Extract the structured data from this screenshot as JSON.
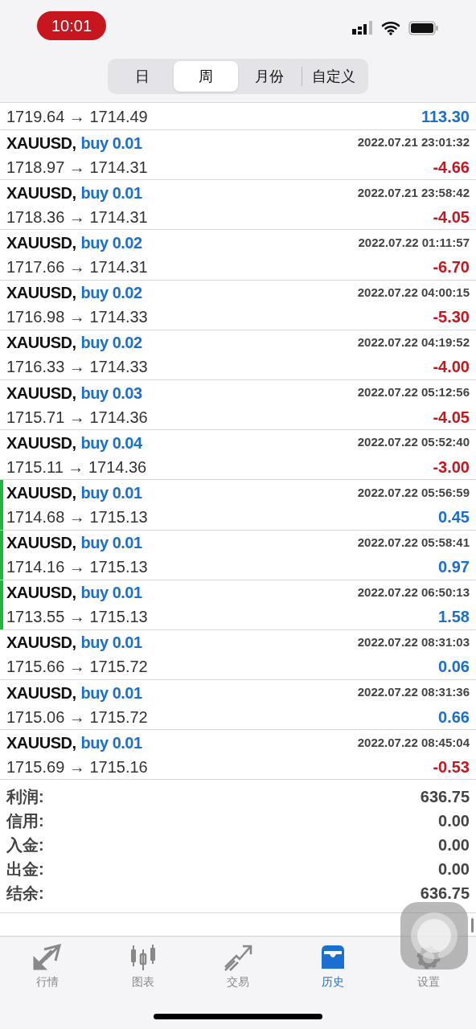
{
  "status_bar": {
    "time": "10:01"
  },
  "segments": [
    {
      "label": "日",
      "selected": false
    },
    {
      "label": "周",
      "selected": true
    },
    {
      "label": "月份",
      "selected": false
    },
    {
      "label": "自定义",
      "selected": false
    }
  ],
  "deals_partial": {
    "prices": "1719.64 → 1714.49",
    "profit": "113.30",
    "kind": "gain"
  },
  "deals": [
    {
      "symbol": "XAUUSD,",
      "side": "buy 0.01",
      "time": "2022.07.21 23:01:32",
      "prices": "1718.97 → 1714.31",
      "profit": "-4.66",
      "kind": "loss",
      "marked": false
    },
    {
      "symbol": "XAUUSD,",
      "side": "buy 0.01",
      "time": "2022.07.21 23:58:42",
      "prices": "1718.36 → 1714.31",
      "profit": "-4.05",
      "kind": "loss",
      "marked": false
    },
    {
      "symbol": "XAUUSD,",
      "side": "buy 0.02",
      "time": "2022.07.22 01:11:57",
      "prices": "1717.66 → 1714.31",
      "profit": "-6.70",
      "kind": "loss",
      "marked": false
    },
    {
      "symbol": "XAUUSD,",
      "side": "buy 0.02",
      "time": "2022.07.22 04:00:15",
      "prices": "1716.98 → 1714.33",
      "profit": "-5.30",
      "kind": "loss",
      "marked": false
    },
    {
      "symbol": "XAUUSD,",
      "side": "buy 0.02",
      "time": "2022.07.22 04:19:52",
      "prices": "1716.33 → 1714.33",
      "profit": "-4.00",
      "kind": "loss",
      "marked": false
    },
    {
      "symbol": "XAUUSD,",
      "side": "buy 0.03",
      "time": "2022.07.22 05:12:56",
      "prices": "1715.71 → 1714.36",
      "profit": "-4.05",
      "kind": "loss",
      "marked": false
    },
    {
      "symbol": "XAUUSD,",
      "side": "buy 0.04",
      "time": "2022.07.22 05:52:40",
      "prices": "1715.11 → 1714.36",
      "profit": "-3.00",
      "kind": "loss",
      "marked": false
    },
    {
      "symbol": "XAUUSD,",
      "side": "buy 0.01",
      "time": "2022.07.22 05:56:59",
      "prices": "1714.68 → 1715.13",
      "profit": "0.45",
      "kind": "gain",
      "marked": true
    },
    {
      "symbol": "XAUUSD,",
      "side": "buy 0.01",
      "time": "2022.07.22 05:58:41",
      "prices": "1714.16 → 1715.13",
      "profit": "0.97",
      "kind": "gain",
      "marked": true
    },
    {
      "symbol": "XAUUSD,",
      "side": "buy 0.01",
      "time": "2022.07.22 06:50:13",
      "prices": "1713.55 → 1715.13",
      "profit": "1.58",
      "kind": "gain",
      "marked": true
    },
    {
      "symbol": "XAUUSD,",
      "side": "buy 0.01",
      "time": "2022.07.22 08:31:03",
      "prices": "1715.66 → 1715.72",
      "profit": "0.06",
      "kind": "gain",
      "marked": false
    },
    {
      "symbol": "XAUUSD,",
      "side": "buy 0.01",
      "time": "2022.07.22 08:31:36",
      "prices": "1715.06 → 1715.72",
      "profit": "0.66",
      "kind": "gain",
      "marked": false
    },
    {
      "symbol": "XAUUSD,",
      "side": "buy 0.01",
      "time": "2022.07.22 08:45:04",
      "prices": "1715.69 → 1715.16",
      "profit": "-0.53",
      "kind": "loss",
      "marked": false
    }
  ],
  "summary": [
    {
      "label": "利润:",
      "value": "636.75"
    },
    {
      "label": "信用:",
      "value": "0.00"
    },
    {
      "label": "入金:",
      "value": "0.00"
    },
    {
      "label": "出金:",
      "value": "0.00"
    },
    {
      "label": "结余:",
      "value": "636.75"
    }
  ],
  "tab_bar": [
    {
      "label": "行情",
      "selected": false
    },
    {
      "label": "图表",
      "selected": false
    },
    {
      "label": "交易",
      "selected": false
    },
    {
      "label": "历史",
      "selected": true
    },
    {
      "label": "设置",
      "selected": false
    }
  ]
}
